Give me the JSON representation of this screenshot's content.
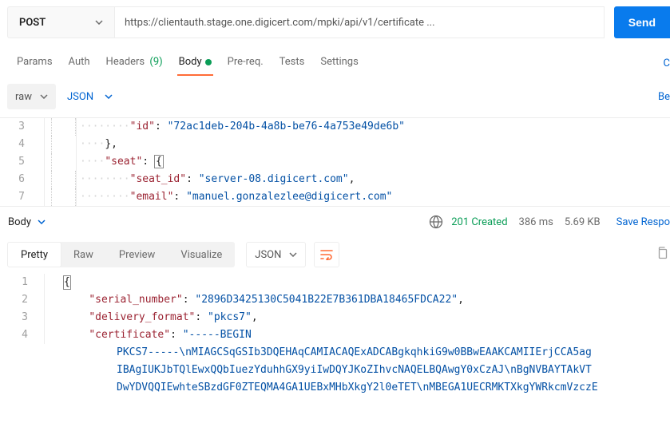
{
  "request": {
    "method": "POST",
    "url": "https://clientauth.stage.one.digicert.com/mpki/api/v1/certificate ...",
    "send": "Send"
  },
  "tabs": {
    "params": "Params",
    "auth": "Auth",
    "headers": "Headers",
    "headers_count": "(9)",
    "body": "Body",
    "prereq": "Pre-req.",
    "tests": "Tests",
    "settings": "Settings",
    "right_cut": "C"
  },
  "bodybar": {
    "raw": "raw",
    "json": "JSON",
    "right_cut": "Be"
  },
  "req_body": {
    "l3_key": "\"id\"",
    "l3_val": "\"72ac1deb-204b-4a8b-be76-4a753e49de6b\"",
    "l4": "},",
    "l5_key": "\"seat\"",
    "l5_brace": "{",
    "l6_key": "\"seat_id\"",
    "l6_val": "\"server-08.digicert.com\"",
    "l7_key": "\"email\"",
    "l7_val": "\"manuel.gonzalezlee@digicert.com\""
  },
  "response": {
    "label": "Body",
    "status": "201 Created",
    "time": "386 ms",
    "size": "5.69 KB",
    "save": "Save Respo"
  },
  "viewer": {
    "pretty": "Pretty",
    "raw": "Raw",
    "preview": "Preview",
    "visualize": "Visualize",
    "json": "JSON"
  },
  "resp_body": {
    "l1": "{",
    "l2_key": "\"serial_number\"",
    "l2_val": "\"2896D3425130C5041B22E7B361DBA18465FDCA22\"",
    "l3_key": "\"delivery_format\"",
    "l3_val": "\"pkcs7\"",
    "l4_key": "\"certificate\"",
    "l4_val_a": "\"-----BEGIN",
    "l4_val_b": "PKCS7-----\\nMIAGCSqGSIb3DQEHAqCAMIACAQExADCABgkqhkiG9w0BBwEAAKCAMIIErjCCA5ag",
    "l4_val_c": "IBAgIUKJbTQlEwxQQbIuezYduhhGX9yiIwDQYJKoZIhvcNAQELBQAwgY0xCzAJ\\nBgNVBAYTAkVT",
    "l4_val_d": "DwYDVQQIEwhteSBzdGF0ZTEQMA4GA1UEBxMHbXkgY2l0eTET\\nMBEGA1UECRMKTXkgYWRkcmVzczE"
  },
  "lineno": {
    "r3": "3",
    "r4": "4",
    "r5": "5",
    "r6": "6",
    "r7": "7",
    "b1": "1",
    "b2": "2",
    "b3": "3",
    "b4": "4"
  }
}
